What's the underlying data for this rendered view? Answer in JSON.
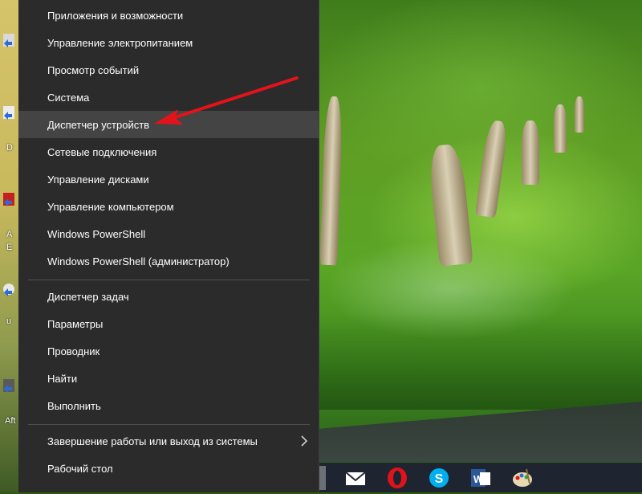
{
  "menu": {
    "group1": [
      {
        "label": "Приложения и возможности"
      },
      {
        "label": "Управление электропитанием"
      },
      {
        "label": "Просмотр событий"
      },
      {
        "label": "Система"
      },
      {
        "label": "Диспетчер устройств",
        "highlighted": true
      },
      {
        "label": "Сетевые подключения"
      },
      {
        "label": "Управление дисками"
      },
      {
        "label": "Управление компьютером"
      },
      {
        "label": "Windows PowerShell"
      },
      {
        "label": "Windows PowerShell (администратор)"
      }
    ],
    "group2": [
      {
        "label": "Диспетчер задач"
      },
      {
        "label": "Параметры"
      },
      {
        "label": "Проводник"
      },
      {
        "label": "Найти"
      },
      {
        "label": "Выполнить"
      }
    ],
    "group3": [
      {
        "label": "Завершение работы или выход из системы",
        "has_submenu": true
      },
      {
        "label": "Рабочий стол"
      }
    ]
  },
  "desktop": {
    "icon_labels": [
      "D",
      "A",
      "E",
      "u",
      "Aft"
    ]
  },
  "taskbar": {
    "icons": [
      "mail-icon",
      "opera-icon",
      "skype-icon",
      "word-icon",
      "paint-icon"
    ]
  },
  "colors": {
    "menu_bg": "#2b2b2b",
    "menu_highlight": "#444444",
    "arrow": "#e3131b",
    "taskbar_bg": "#1f2530"
  }
}
